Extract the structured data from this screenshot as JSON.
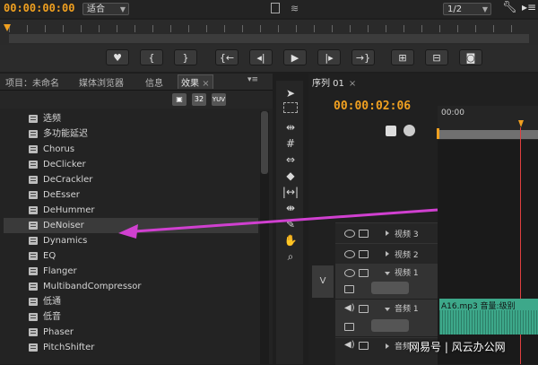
{
  "source_monitor": {
    "timecode": "00:00:00:00",
    "fit_select": "适合",
    "ratio_select": "1/2"
  },
  "transport": {
    "buttons": [
      "marker",
      "mark-in",
      "mark-out",
      "go-to-in",
      "step-back",
      "play",
      "step-forward",
      "go-to-out",
      "insert",
      "overwrite",
      "export-frame"
    ]
  },
  "panel_tabs": [
    "项目：未命名",
    "媒体浏览器",
    "信息",
    "效果"
  ],
  "active_tab": "效果",
  "fx_toolbar": {
    "btn_32": "32",
    "btn_yuv": "YUV"
  },
  "effects": [
    "选频",
    "多功能延迟",
    "Chorus",
    "DeClicker",
    "DeCrackler",
    "DeEsser",
    "DeHummer",
    "DeNoiser",
    "Dynamics",
    "EQ",
    "Flanger",
    "MultibandCompressor",
    "低通",
    "低音",
    "Phaser",
    "PitchShifter"
  ],
  "selected_effect": "DeNoiser",
  "sequence": {
    "tab": "序列 01",
    "timecode": "00:00:02:06",
    "ruler_time": "00:00",
    "tracks": [
      {
        "name": "视频 3"
      },
      {
        "name": "视频 2"
      },
      {
        "name": "视频 1"
      },
      {
        "name": "音频 1"
      },
      {
        "name": "音频"
      }
    ],
    "v_label": "V",
    "clip_label": "A16.mp3 音量:级别"
  },
  "watermark": "网易号 | 风云办公网",
  "colors": {
    "accent": "#f0a020",
    "clip": "#3da88a",
    "arrow": "#d040d0",
    "playhead": "#e04040"
  }
}
